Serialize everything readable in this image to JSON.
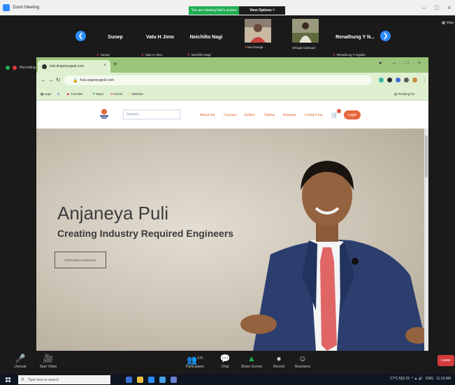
{
  "zoom": {
    "window_title": "Zoom Meeting",
    "share_banner": "You are viewing Neil's screen",
    "view_options": "View Options ˅",
    "view_button": "View",
    "recording_label": "Recording..."
  },
  "participants": [
    {
      "name": "Sunep",
      "sub": "Sunep"
    },
    {
      "name": "Vatu H Jimo",
      "sub": "Vatu H Jimo"
    },
    {
      "name": "Neichilto Nagi",
      "sub": "Neichilto Nagi"
    },
    {
      "name": "",
      "sub": "Nacchangti..."
    },
    {
      "name": "",
      "sub": "Shrujal Gaikwad"
    },
    {
      "name": "Renathung Y N...",
      "sub": "Renathung Y Ngullie"
    }
  ],
  "browser": {
    "tab_title": "hub.Anjaneyapuli.com",
    "url": "hub.anjaneyapuli.com",
    "bookmarks": [
      "Apps",
      "G",
      "YouTube",
      "Maps",
      "Gmail",
      "Website"
    ],
    "reading_list": "Reading list"
  },
  "site": {
    "search_placeholder": "Search",
    "nav": [
      "About me",
      "Courses",
      "Gallery",
      "Videos",
      "Reviews",
      "Contact me"
    ],
    "login": "Login",
    "hero_title": "Anjaneya Puli",
    "hero_subtitle": "Creating Industry Required Engineers",
    "explore": "EXPLORE COURSES"
  },
  "toolbar": {
    "unmute": "Unmute",
    "start_video": "Start Video",
    "participants": "Participants",
    "participants_count": "141",
    "chat": "Chat",
    "share_screen": "Share Screen",
    "record": "Record",
    "reactions": "Reactions",
    "leave": "Leave"
  },
  "taskbar": {
    "search_placeholder": "Type here to search",
    "weather": "27°C AQI 15",
    "time": "11:12 AM",
    "lang": "ENG"
  },
  "colors": {
    "zoom_blue": "#2d8cff",
    "share_green": "#1fae52",
    "brand_orange": "#e8673c",
    "tab_green": "#9bc47a"
  }
}
